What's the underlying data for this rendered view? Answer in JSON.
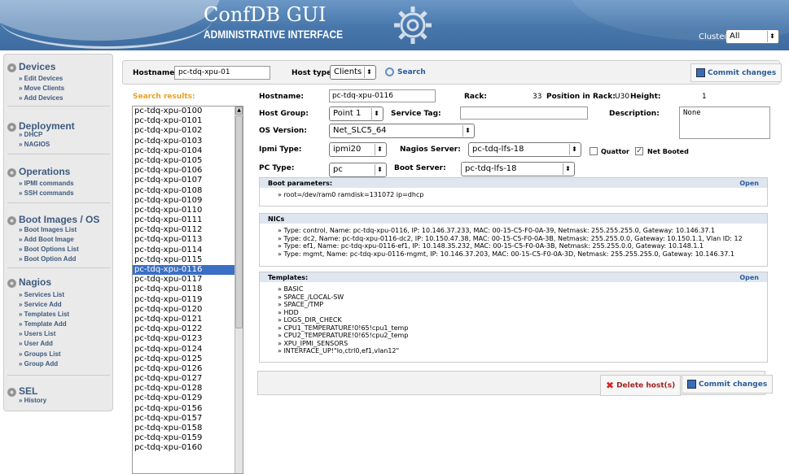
{
  "header": {
    "title": "ConfDB GUI",
    "subtitle": "ADMINISTRATIVE INTERFACE",
    "cluster_label": "Cluster:",
    "cluster_value": "All"
  },
  "sidebar": {
    "sections": [
      {
        "title": "Devices",
        "items": [
          "Edit Devices",
          "Move Clients",
          "Add Devices"
        ]
      },
      {
        "title": "Deployment",
        "items": [
          "DHCP",
          "NAGIOS"
        ]
      },
      {
        "title": "Operations",
        "items": [
          "IPMI commands",
          "SSH commands"
        ]
      },
      {
        "title": "Boot Images / OS",
        "items": [
          "Boot Images List",
          "Add Boot Image",
          "Boot Options List",
          "Boot Option Add"
        ]
      },
      {
        "title": "Nagios",
        "items": [
          "Services List",
          "Service Add",
          "Templates List",
          "Template Add",
          "Users List",
          "User Add",
          "Groups List",
          "Group Add"
        ]
      },
      {
        "title": "SEL",
        "items": [
          "History"
        ]
      }
    ]
  },
  "search": {
    "hostname_label": "Hostname:",
    "hostname_value": "pc-tdq-xpu-01",
    "hosttype_label": "Host type:",
    "hosttype_value": "Clients",
    "search_button": "Search",
    "commit_button": "Commit changes",
    "results_label": "Search results:"
  },
  "host_list": [
    "pc-tdq-xpu-0100",
    "pc-tdq-xpu-0101",
    "pc-tdq-xpu-0102",
    "pc-tdq-xpu-0103",
    "pc-tdq-xpu-0104",
    "pc-tdq-xpu-0105",
    "pc-tdq-xpu-0106",
    "pc-tdq-xpu-0107",
    "pc-tdq-xpu-0108",
    "pc-tdq-xpu-0109",
    "pc-tdq-xpu-0110",
    "pc-tdq-xpu-0111",
    "pc-tdq-xpu-0112",
    "pc-tdq-xpu-0113",
    "pc-tdq-xpu-0114",
    "pc-tdq-xpu-0115",
    "pc-tdq-xpu-0116",
    "pc-tdq-xpu-0117",
    "pc-tdq-xpu-0118",
    "pc-tdq-xpu-0119",
    "pc-tdq-xpu-0120",
    "pc-tdq-xpu-0121",
    "pc-tdq-xpu-0122",
    "pc-tdq-xpu-0123",
    "pc-tdq-xpu-0124",
    "pc-tdq-xpu-0125",
    "pc-tdq-xpu-0126",
    "pc-tdq-xpu-0127",
    "pc-tdq-xpu-0128",
    "pc-tdq-xpu-0129",
    "pc-tdq-xpu-0156",
    "pc-tdq-xpu-0157",
    "pc-tdq-xpu-0158",
    "pc-tdq-xpu-0159",
    "pc-tdq-xpu-0160"
  ],
  "selected_host": "pc-tdq-xpu-0116",
  "detail": {
    "hostname_label": "Hostname:",
    "hostname_value": "pc-tdq-xpu-0116",
    "rack_label": "Rack:",
    "rack_value": "33",
    "position_label": "Position in Rack:",
    "position_value": "U30",
    "height_label": "Height:",
    "height_value": "1",
    "hostgroup_label": "Host Group:",
    "hostgroup_value": "Point 1",
    "servicetag_label": "Service Tag:",
    "servicetag_value": "",
    "description_label": "Description:",
    "description_value": "None",
    "os_label": "OS Version:",
    "os_value": "Net_SLC5_64",
    "ipmi_label": "Ipmi Type:",
    "ipmi_value": "ipmi20",
    "nagios_label": "Nagios Server:",
    "nagios_value": "pc-tdq-lfs-18",
    "quattor_label": "Quattor",
    "netbooted_label": "Net Booted",
    "netbooted_checkmark": "✓",
    "pctype_label": "PC Type:",
    "pctype_value": "pc",
    "bootserver_label": "Boot Server:",
    "bootserver_value": "pc-tdq-lfs-18"
  },
  "boot_params": {
    "title": "Boot parameters:",
    "open": "Open",
    "lines": [
      "root=/dev/ram0 ramdisk=131072 ip=dhcp"
    ]
  },
  "nics": {
    "title": "NICs",
    "lines": [
      "Type: control, Name: pc-tdq-xpu-0116, IP: 10.146.37.233, MAC: 00-15-C5-F0-0A-39, Netmask: 255.255.255.0, Gateway: 10.146.37.1",
      "Type: dc2, Name: pc-tdq-xpu-0116-dc2, IP: 10.150.47.38, MAC: 00-15-C5-F0-0A-3B, Netmask: 255.255.0.0, Gateway: 10.150.1.1, Vlan ID: 12",
      "Type: ef1, Name: pc-tdq-xpu-0116-ef1, IP: 10.148.35.232, MAC: 00-15-C5-F0-0A-3B, Netmask: 255.255.0.0, Gateway: 10.148.1.1",
      "Type: mgmt, Name: pc-tdq-xpu-0116-mgmt, IP: 10.146.37.203, MAC: 00-15-C5-F0-0A-3D, Netmask: 255.255.255.0, Gateway: 10.146.37.1"
    ]
  },
  "templates": {
    "title": "Templates:",
    "open": "Open",
    "lines": [
      "BASIC",
      "SPACE_/LOCAL-SW",
      "SPACE_/TMP",
      "HDD",
      "LOGS_DIR_CHECK",
      "CPU1_TEMPERATURE!0!65!cpu1_temp",
      "CPU2_TEMPERATURE!0!65!cpu2_temp",
      "XPU_IPMI_SENSORS",
      "INTERFACE_UP!\"lo,ctrl0,ef1,vlan12\""
    ]
  },
  "actions": {
    "delete_button": "Delete host(s)",
    "commit_button": "Commit changes"
  }
}
